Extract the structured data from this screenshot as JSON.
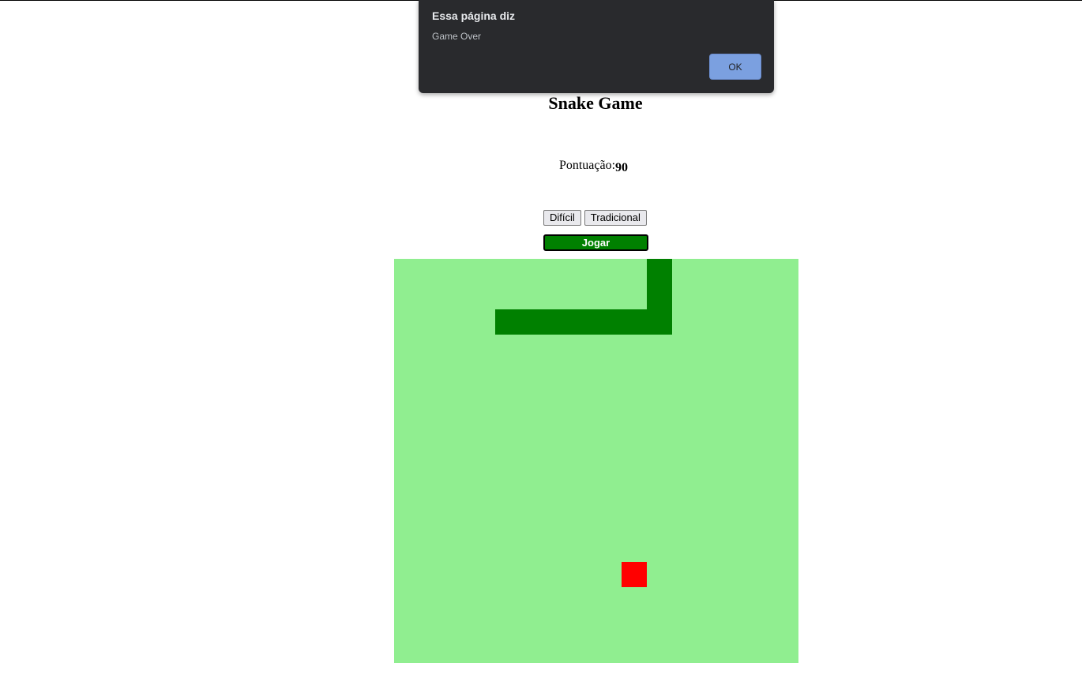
{
  "page": {
    "title": "Snake Game",
    "score_label": "Pontuação:",
    "score_value": "90"
  },
  "modes": [
    {
      "label": "Difícil"
    },
    {
      "label": "Tradicional"
    }
  ],
  "play_button": {
    "label": "Jogar",
    "color": "#008000"
  },
  "game": {
    "grid_cells": 16,
    "board_color": "#90ee90",
    "snake_color": "#008000",
    "food_color": "#ff0000",
    "snake": [
      [
        4,
        2
      ],
      [
        5,
        2
      ],
      [
        6,
        2
      ],
      [
        7,
        2
      ],
      [
        8,
        2
      ],
      [
        9,
        2
      ],
      [
        10,
        2
      ],
      [
        10,
        1
      ],
      [
        10,
        0
      ]
    ],
    "food": [
      9,
      12
    ]
  },
  "dialog": {
    "title": "Essa página diz",
    "message": "Game Over",
    "ok_label": "OK",
    "ok_color": "#7ba0e0"
  }
}
